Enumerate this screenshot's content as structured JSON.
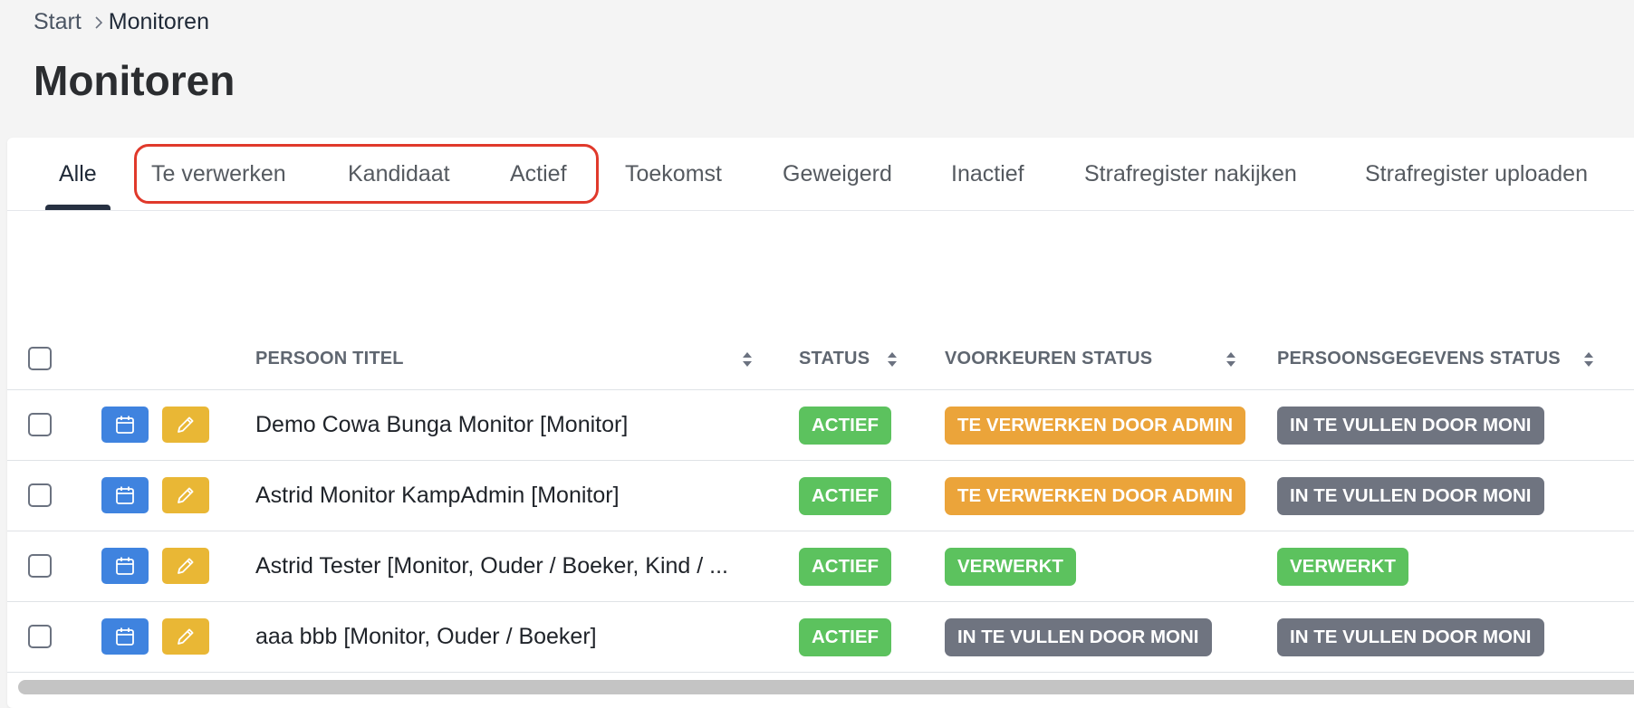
{
  "breadcrumb": {
    "home": "Start",
    "current": "Monitoren"
  },
  "page_title": "Monitoren",
  "tabs": [
    "Alle",
    "Te verwerken",
    "Kandidaat",
    "Actief",
    "Toekomst",
    "Geweigerd",
    "Inactief",
    "Strafregister nakijken",
    "Strafregister uploaden"
  ],
  "active_tab": "Alle",
  "table": {
    "columns": {
      "title": "PERSOON TITEL",
      "status": "STATUS",
      "prefs": "VOORKEUREN STATUS",
      "personal": "PERSOONSGEGEVENS STATUS"
    },
    "rows": [
      {
        "title": "Demo Cowa Bunga Monitor [Monitor]",
        "status": "ACTIEF",
        "prefs": "TE VERWERKEN DOOR ADMIN",
        "personal": "IN TE VULLEN DOOR MONI"
      },
      {
        "title": "Astrid Monitor KampAdmin [Monitor]",
        "status": "ACTIEF",
        "prefs": "TE VERWERKEN DOOR ADMIN",
        "personal": "IN TE VULLEN DOOR MONI"
      },
      {
        "title": "Astrid Tester [Monitor, Ouder / Boeker, Kind / ...",
        "status": "ACTIEF",
        "prefs": "VERWERKT",
        "personal": "VERWERKT"
      },
      {
        "title": "aaa bbb [Monitor, Ouder / Boeker]",
        "status": "ACTIEF",
        "prefs": "IN TE VULLEN DOOR MONI",
        "personal": "IN TE VULLEN DOOR MONI"
      }
    ]
  },
  "colors": {
    "highlight": "#e0392b",
    "badge_green": "#5cc25e",
    "badge_orange": "#eba43a",
    "badge_gray": "#6f7480",
    "calendar_button": "#3f83df",
    "edit_button": "#e9b735"
  },
  "icons": {
    "breadcrumb_separator": "chevron-right-icon",
    "sort": "sort-icon",
    "calendar": "calendar-icon",
    "edit": "pencil-icon"
  }
}
